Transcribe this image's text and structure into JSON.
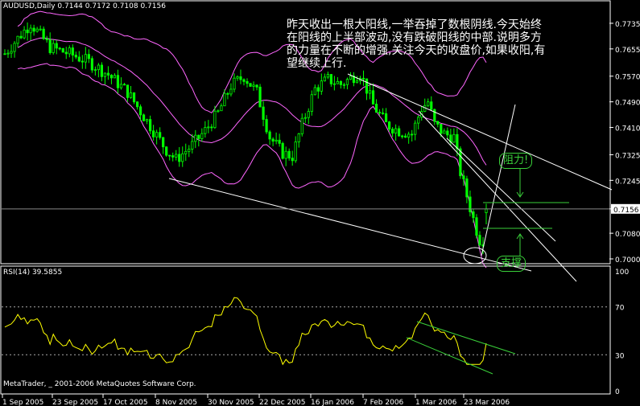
{
  "header": {
    "title": "AUDUSD,Daily  0.7144 0.7172 0.7108 0.7156"
  },
  "annotation": {
    "text": "昨天收出一根大阳线,一举吞掉了数根阴线.今天始终在阳线的上半部波动,没有跌破阳线的中部.说明多方的力量在不断的增强,关注今天的收盘价,如果收阳,有望继续上行."
  },
  "labels": {
    "resistance": "阻力!",
    "support": "支撑"
  },
  "rsi": {
    "title": "RSI(14) 39.5855",
    "levels": [
      "100",
      "70",
      "30",
      "0"
    ]
  },
  "footer": {
    "copyright": "MetaTrader, _ 2001-2006 MetaQuotes Software Corp."
  },
  "price_axis": {
    "ticks": [
      "0.7735",
      "0.7655",
      "0.7570",
      "0.7490",
      "0.7410",
      "0.7325",
      "0.7245",
      "0.7156",
      "0.7080",
      "0.7000"
    ],
    "current_price": "0.7156"
  },
  "time_axis": {
    "labels": [
      "1 Sep 2005",
      "23 Sep 2005",
      "17 Oct 2005",
      "8 Nov 2005",
      "30 Nov 2005",
      "22 Dec 2005",
      "16 Jan 2006",
      "7 Feb 2006",
      "1 Mar 2006",
      "23 Mar 2006"
    ]
  },
  "colors": {
    "background": "#000000",
    "candle": "#00ff00",
    "bands": "#ff66ff",
    "rsi_line": "#ffff00",
    "trendline": "#ffffff",
    "label_green": "#3ad13a"
  },
  "chart_data": {
    "type": "candlestick",
    "symbol": "AUDUSD",
    "timeframe": "Daily",
    "last_bar": {
      "open": 0.7144,
      "high": 0.7172,
      "low": 0.7108,
      "close": 0.7156
    },
    "ylim": [
      0.7,
      0.7775
    ],
    "indicators": [
      "Bollinger Bands",
      "RSI(14)"
    ],
    "rsi_value": 39.5855
  }
}
